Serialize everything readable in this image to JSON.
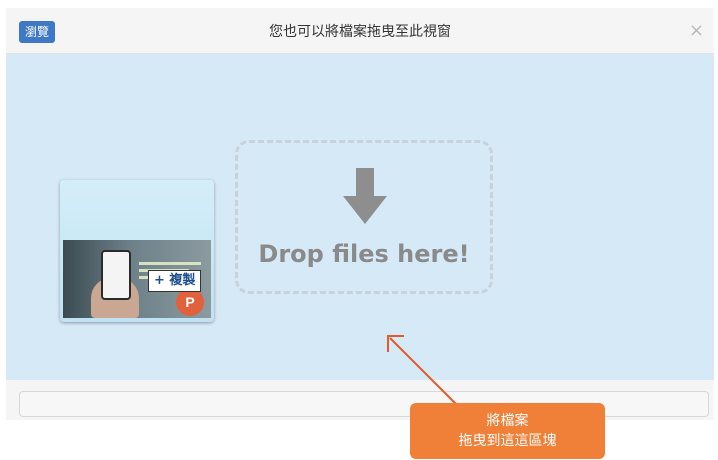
{
  "header": {
    "browse_label": "瀏覽",
    "title": "您也可以將檔案拖曳至此視窗",
    "close_glyph": "×"
  },
  "drop_zone": {
    "text": "Drop files here!",
    "icon": "arrow-down-icon"
  },
  "file_item": {
    "copy_label": "+ 複製",
    "type_icon": "powerpoint-icon",
    "type_letter": "P"
  },
  "callout": {
    "line1": "將檔案",
    "line2": "拖曳到這這區塊"
  },
  "colors": {
    "accent": "#3f79c5",
    "drop_background": "#d6e9f7",
    "callout": "#f07f37"
  }
}
